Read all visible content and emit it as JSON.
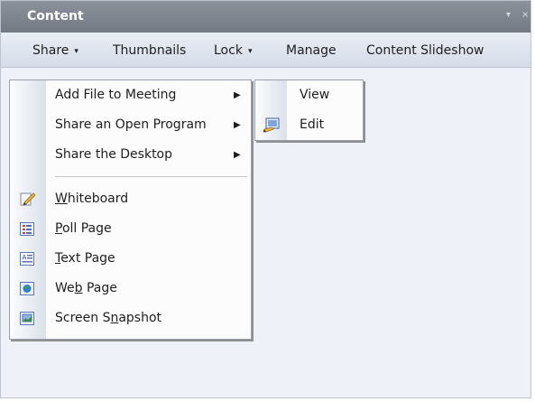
{
  "window": {
    "title": "Content",
    "menu_button": "▾",
    "close_button": "×"
  },
  "menubar": {
    "share": {
      "label": "Share",
      "arrow": "▾"
    },
    "thumbnails": {
      "label": "Thumbnails"
    },
    "lock": {
      "label": "Lock",
      "arrow": "▾"
    },
    "manage": {
      "label": "Manage"
    },
    "slideshow": {
      "label": "Content Slideshow"
    }
  },
  "share_menu": {
    "items": [
      {
        "label": "Add File to Meeting",
        "submenu_arrow": "▶"
      },
      {
        "label": "Share an Open Program",
        "submenu_arrow": "▶"
      },
      {
        "label": "Share the Desktop",
        "submenu_arrow": "▶"
      },
      {
        "mnemonic": "W",
        "rest": "hiteboard",
        "icon": "whiteboard-icon"
      },
      {
        "mnemonic": "P",
        "rest": "oll Page",
        "icon": "poll-page-icon"
      },
      {
        "mnemonic": "T",
        "rest": "ext Page",
        "icon": "text-page-icon"
      },
      {
        "before": "We",
        "mnemonic": "b",
        "rest": " Page",
        "icon": "web-page-icon"
      },
      {
        "before": "Screen S",
        "mnemonic": "n",
        "rest": "apshot",
        "icon": "screen-snapshot-icon"
      }
    ]
  },
  "sub_menu": {
    "items": [
      {
        "label": "View"
      },
      {
        "label": "Edit",
        "icon": "edit-icon"
      }
    ]
  }
}
